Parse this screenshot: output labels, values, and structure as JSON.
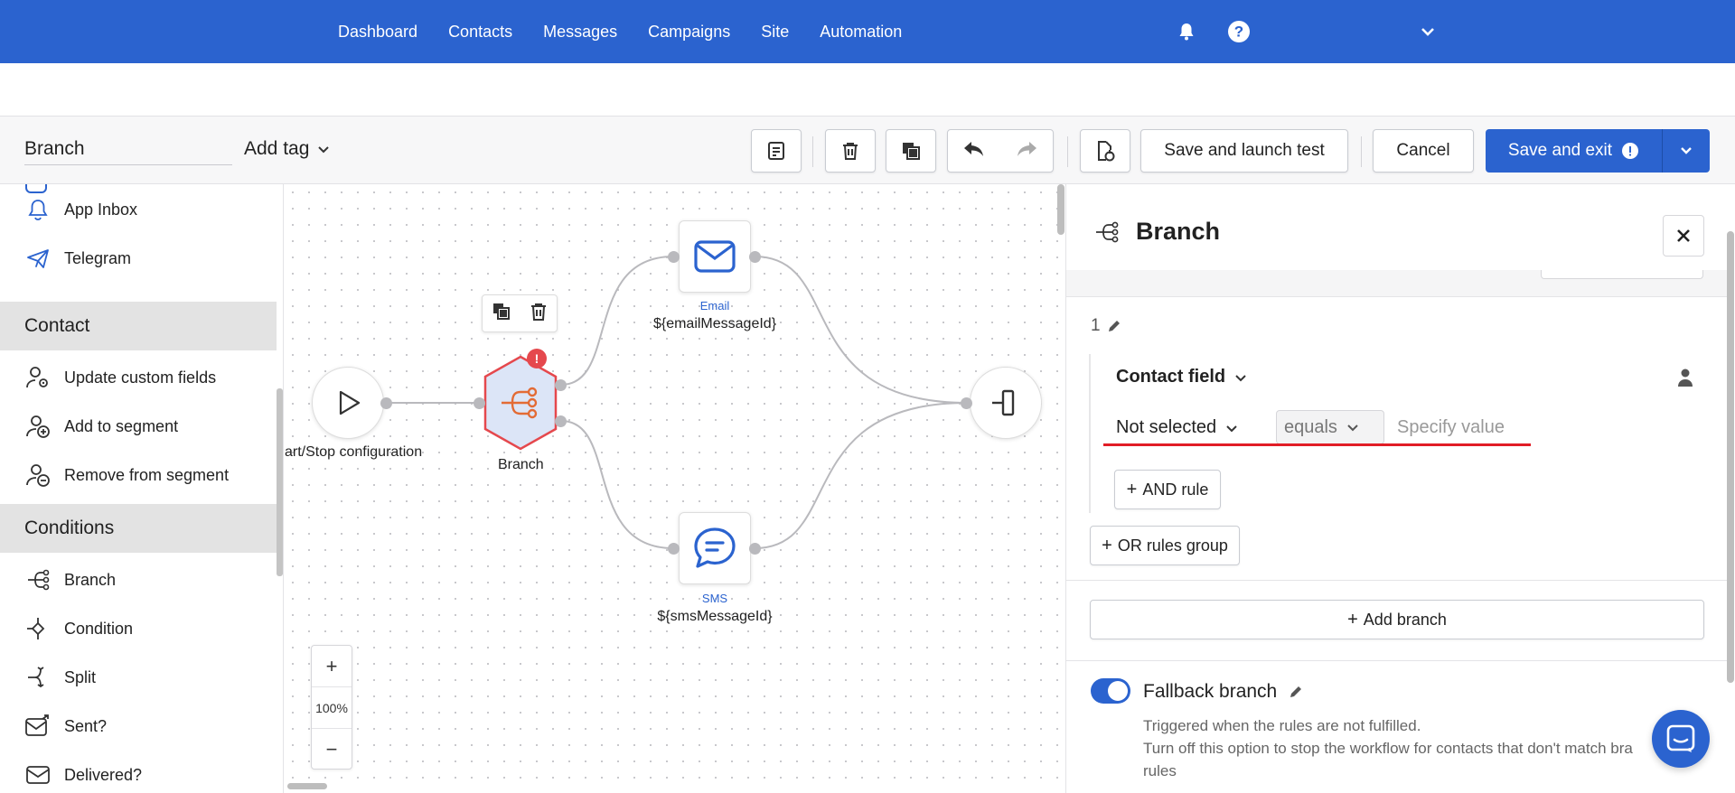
{
  "nav": {
    "items": [
      "Dashboard",
      "Contacts",
      "Messages",
      "Campaigns",
      "Site",
      "Automation"
    ],
    "icons": [
      "bell-icon",
      "help-icon",
      "chevron-down-icon"
    ]
  },
  "toolbar": {
    "workflow_name": "Branch",
    "add_tag": "Add tag",
    "save_launch_test": "Save and launch test",
    "cancel": "Cancel",
    "save_exit": "Save and exit"
  },
  "sidebar": {
    "items_top": [
      {
        "label": "App Inbox",
        "icon": "bell-icon"
      },
      {
        "label": "Telegram",
        "icon": "paper-plane-icon"
      }
    ],
    "section_contact": "Contact",
    "items_contact": [
      {
        "label": "Update custom fields",
        "icon": "user-settings-icon"
      },
      {
        "label": "Add to segment",
        "icon": "user-add-icon"
      },
      {
        "label": "Remove from segment",
        "icon": "user-remove-icon"
      }
    ],
    "section_conditions": "Conditions",
    "items_conditions": [
      {
        "label": "Branch",
        "icon": "branch-icon"
      },
      {
        "label": "Condition",
        "icon": "condition-icon"
      },
      {
        "label": "Split",
        "icon": "split-icon"
      },
      {
        "label": "Sent?",
        "icon": "mail-sent-icon"
      },
      {
        "label": "Delivered?",
        "icon": "mail-icon"
      }
    ]
  },
  "canvas": {
    "start_label": "art/Stop configuration",
    "branch_label": "Branch",
    "email_type": "Email",
    "email_id": "${emailMessageId}",
    "sms_type": "SMS",
    "sms_id": "${smsMessageId}",
    "zoom_level": "100%",
    "zoom_in": "+",
    "zoom_out": "−"
  },
  "panel": {
    "title": "Branch",
    "branch_number": "1",
    "contact_field": "Contact field",
    "field_value": "Not selected",
    "operator": "equals",
    "value_placeholder": "Specify value",
    "and_rule": "AND rule",
    "or_rules_group": "OR rules group",
    "add_branch": "Add branch",
    "fallback_title": "Fallback branch",
    "fallback_desc1": "Triggered when the rules are not fulfilled.",
    "fallback_desc2": "Turn off this option to stop the workflow for contacts that don't match bra",
    "fallback_desc3": "rules",
    "fallback_enabled": true
  },
  "colors": {
    "brand": "#2b63cf",
    "error": "#e5484d",
    "node_fill": "#dce5f7"
  }
}
